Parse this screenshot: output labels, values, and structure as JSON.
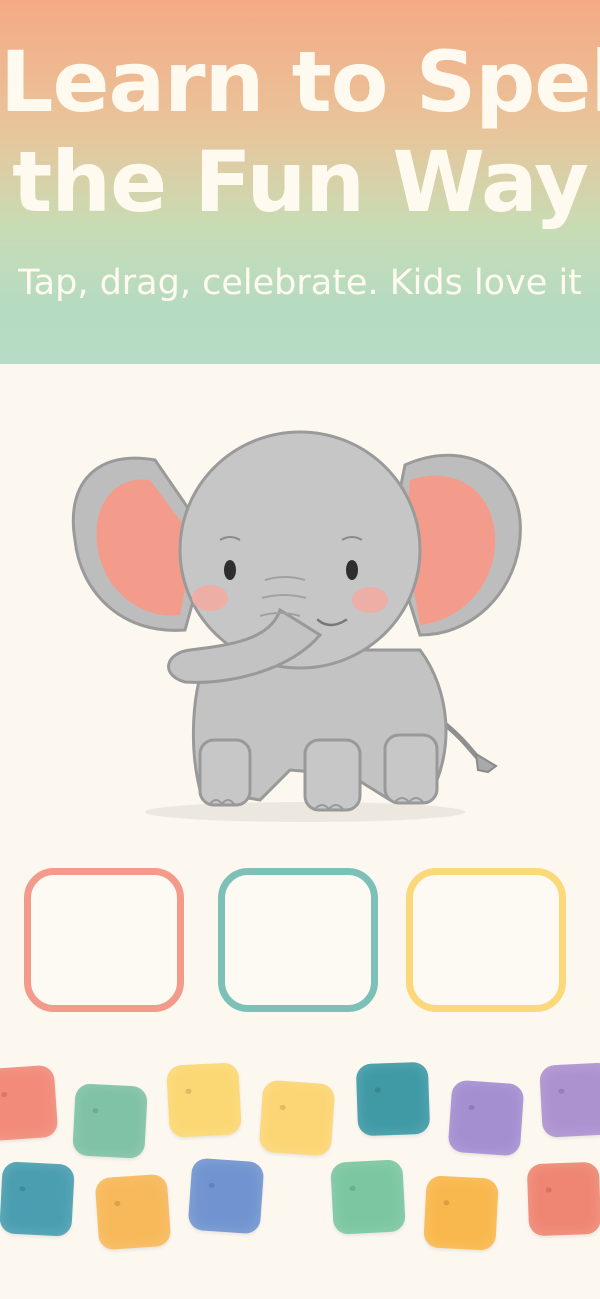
{
  "hero": {
    "title_line1": "Learn to Spell",
    "title_line2": "the Fun Way",
    "subtitle": "Tap, drag, celebrate. Kids love it"
  },
  "illustration": {
    "subject": "elephant",
    "icon": "elephant-illustration"
  },
  "answer_slots": [
    {
      "color": "#f39a8a"
    },
    {
      "color": "#7cc0b8"
    },
    {
      "color": "#fbd97a"
    }
  ],
  "letter_tiles": [
    {
      "color": "#f28b7a"
    },
    {
      "color": "#7fc2a6"
    },
    {
      "color": "#fbd873"
    },
    {
      "color": "#fcd674"
    },
    {
      "color": "#3f9aa6"
    },
    {
      "color": "#a48fd1"
    },
    {
      "color": "#ad92d0"
    },
    {
      "color": "#4a9eb0"
    },
    {
      "color": "#f7b95a"
    },
    {
      "color": "#7194d0"
    },
    {
      "color": "#7cc7a1"
    },
    {
      "color": "#f9b84d"
    },
    {
      "color": "#ef8673"
    }
  ]
}
